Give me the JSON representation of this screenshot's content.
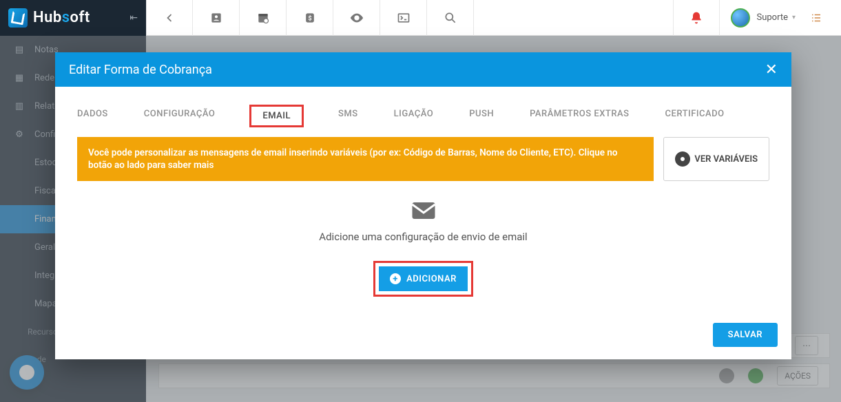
{
  "brand": {
    "part1": "Hub",
    "part2": "s",
    "part3": "oft"
  },
  "topbar_icons": [
    "back",
    "contact",
    "calendar",
    "billing",
    "eye",
    "terminal",
    "search"
  ],
  "user": {
    "label": "Suporte"
  },
  "sidebar": {
    "items": [
      {
        "icon": "doc",
        "label": "Notas"
      },
      {
        "icon": "grid",
        "label": "Rede"
      },
      {
        "icon": "doc",
        "label": "Relatórios"
      },
      {
        "icon": "gear",
        "label": "Configurações"
      },
      {
        "icon": "none",
        "label": "Estoque"
      },
      {
        "icon": "none",
        "label": "Fiscal"
      },
      {
        "icon": "none",
        "label": "Financeiro",
        "active": true
      },
      {
        "icon": "none",
        "label": "Geral"
      },
      {
        "icon": "none",
        "label": "Integração"
      },
      {
        "icon": "none",
        "label": "Mapas"
      },
      {
        "icon": "none",
        "label": "Recursos Humanos"
      },
      {
        "icon": "none",
        "label": "Rede"
      }
    ]
  },
  "bg_table": {
    "actions_label": "AÇÕES"
  },
  "modal": {
    "title": "Editar Forma de Cobrança",
    "tabs": [
      "DADOS",
      "CONFIGURAÇÃO",
      "EMAIL",
      "SMS",
      "LIGAÇÃO",
      "PUSH",
      "PARÂMETROS EXTRAS",
      "CERTIFICADO"
    ],
    "active_tab_index": 2,
    "alert_text": "Você pode personalizar as mensagens de email inserindo variáveis (por ex: Código de Barras, Nome do Cliente, ETC). Clique no botão ao lado para saber mais",
    "var_button": "VER VARIÁVEIS",
    "empty_text": "Adicione uma configuração de envio de email",
    "add_button": "ADICIONAR",
    "save_button": "SALVAR"
  }
}
